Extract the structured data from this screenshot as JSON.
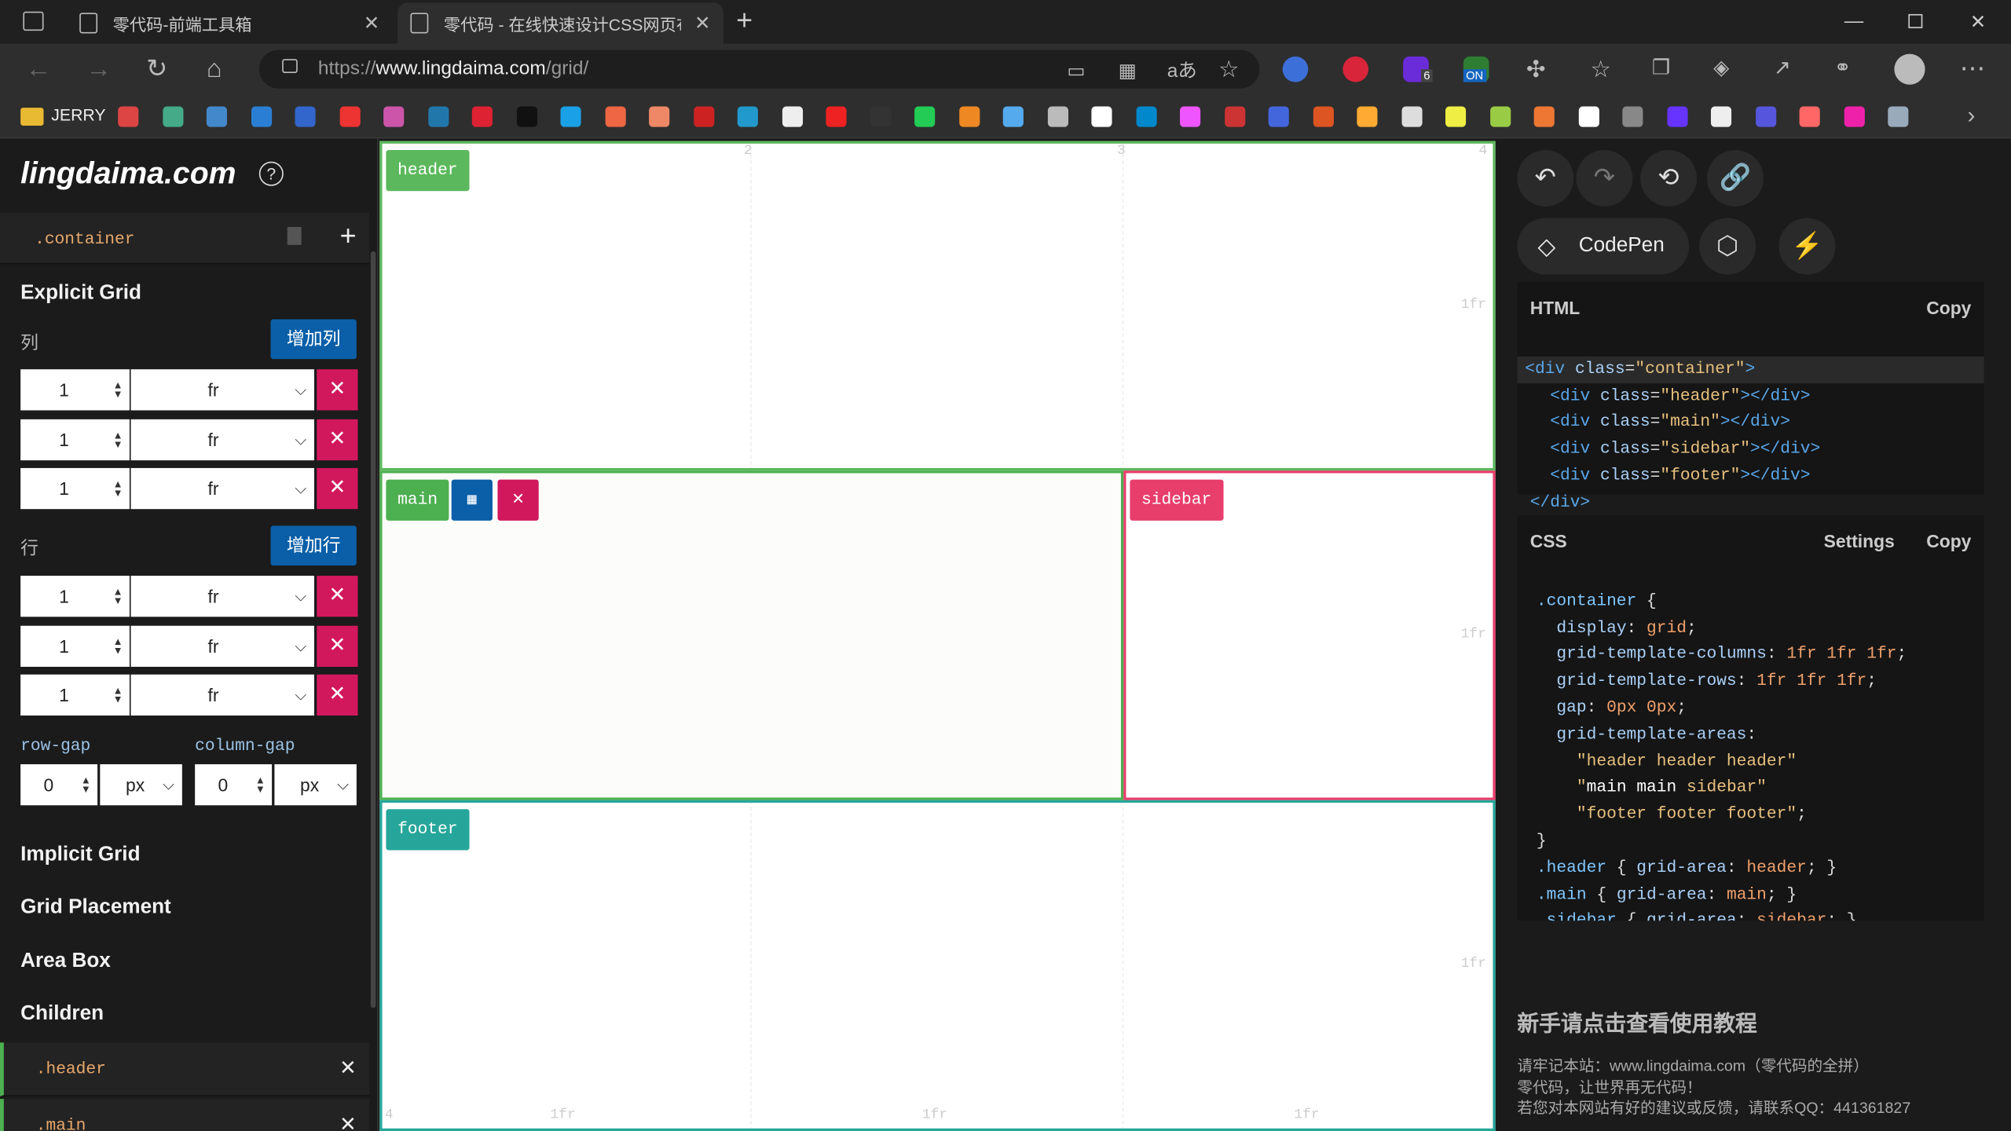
{
  "browser": {
    "tabs": [
      {
        "label": "零代码-前端工具箱"
      },
      {
        "label": "零代码 - 在线快速设计CSS网页布"
      }
    ],
    "url_prefix": "https://",
    "url_host": "www.lingdaima.com",
    "url_path": "/grid/",
    "bookmarks_first": "JERRY",
    "ext_badge": "6",
    "ext_on": "ON"
  },
  "left": {
    "logo": "lingdaima.com",
    "help": "?",
    "container": ".container",
    "explicit": "Explicit Grid",
    "columns_label": "列",
    "add_column": "增加列",
    "columns": [
      {
        "value": "1",
        "unit": "fr"
      },
      {
        "value": "1",
        "unit": "fr"
      },
      {
        "value": "1",
        "unit": "fr"
      }
    ],
    "rows_label": "行",
    "add_row": "增加行",
    "rows": [
      {
        "value": "1",
        "unit": "fr"
      },
      {
        "value": "1",
        "unit": "fr"
      },
      {
        "value": "1",
        "unit": "fr"
      }
    ],
    "row_gap_label": "row-gap",
    "column_gap_label": "column-gap",
    "row_gap": {
      "value": "0",
      "unit": "px"
    },
    "column_gap": {
      "value": "0",
      "unit": "px"
    },
    "implicit": "Implicit Grid",
    "placement": "Grid Placement",
    "areabox": "Area Box",
    "children": "Children",
    "child_items": [
      ".header",
      ".main"
    ]
  },
  "canvas": {
    "header": "header",
    "main": "main",
    "sidebar": "sidebar",
    "footer": "footer",
    "col_nums": [
      "2",
      "3",
      "4"
    ],
    "row_fr": "1fr",
    "col_fr": "1fr",
    "bottom_num": "4",
    "colors": {
      "header": "#5cb85c",
      "main": "#4caf50",
      "sidebar": "#e83e6c",
      "footer": "#26a69a",
      "blue": "#0a5fa8",
      "red": "#d2185d"
    }
  },
  "right": {
    "codepen": "CodePen",
    "html_label": "HTML",
    "copy": "Copy",
    "css_label": "CSS",
    "settings": "Settings",
    "tutorial": "新手请点击查看使用教程",
    "info1": "请牢记本站：www.lingdaima.com（零代码的全拼）",
    "info2": "零代码，让世界再无代码！",
    "info3": "若您对本网站有好的建议或反馈，请联系QQ：441361827"
  }
}
